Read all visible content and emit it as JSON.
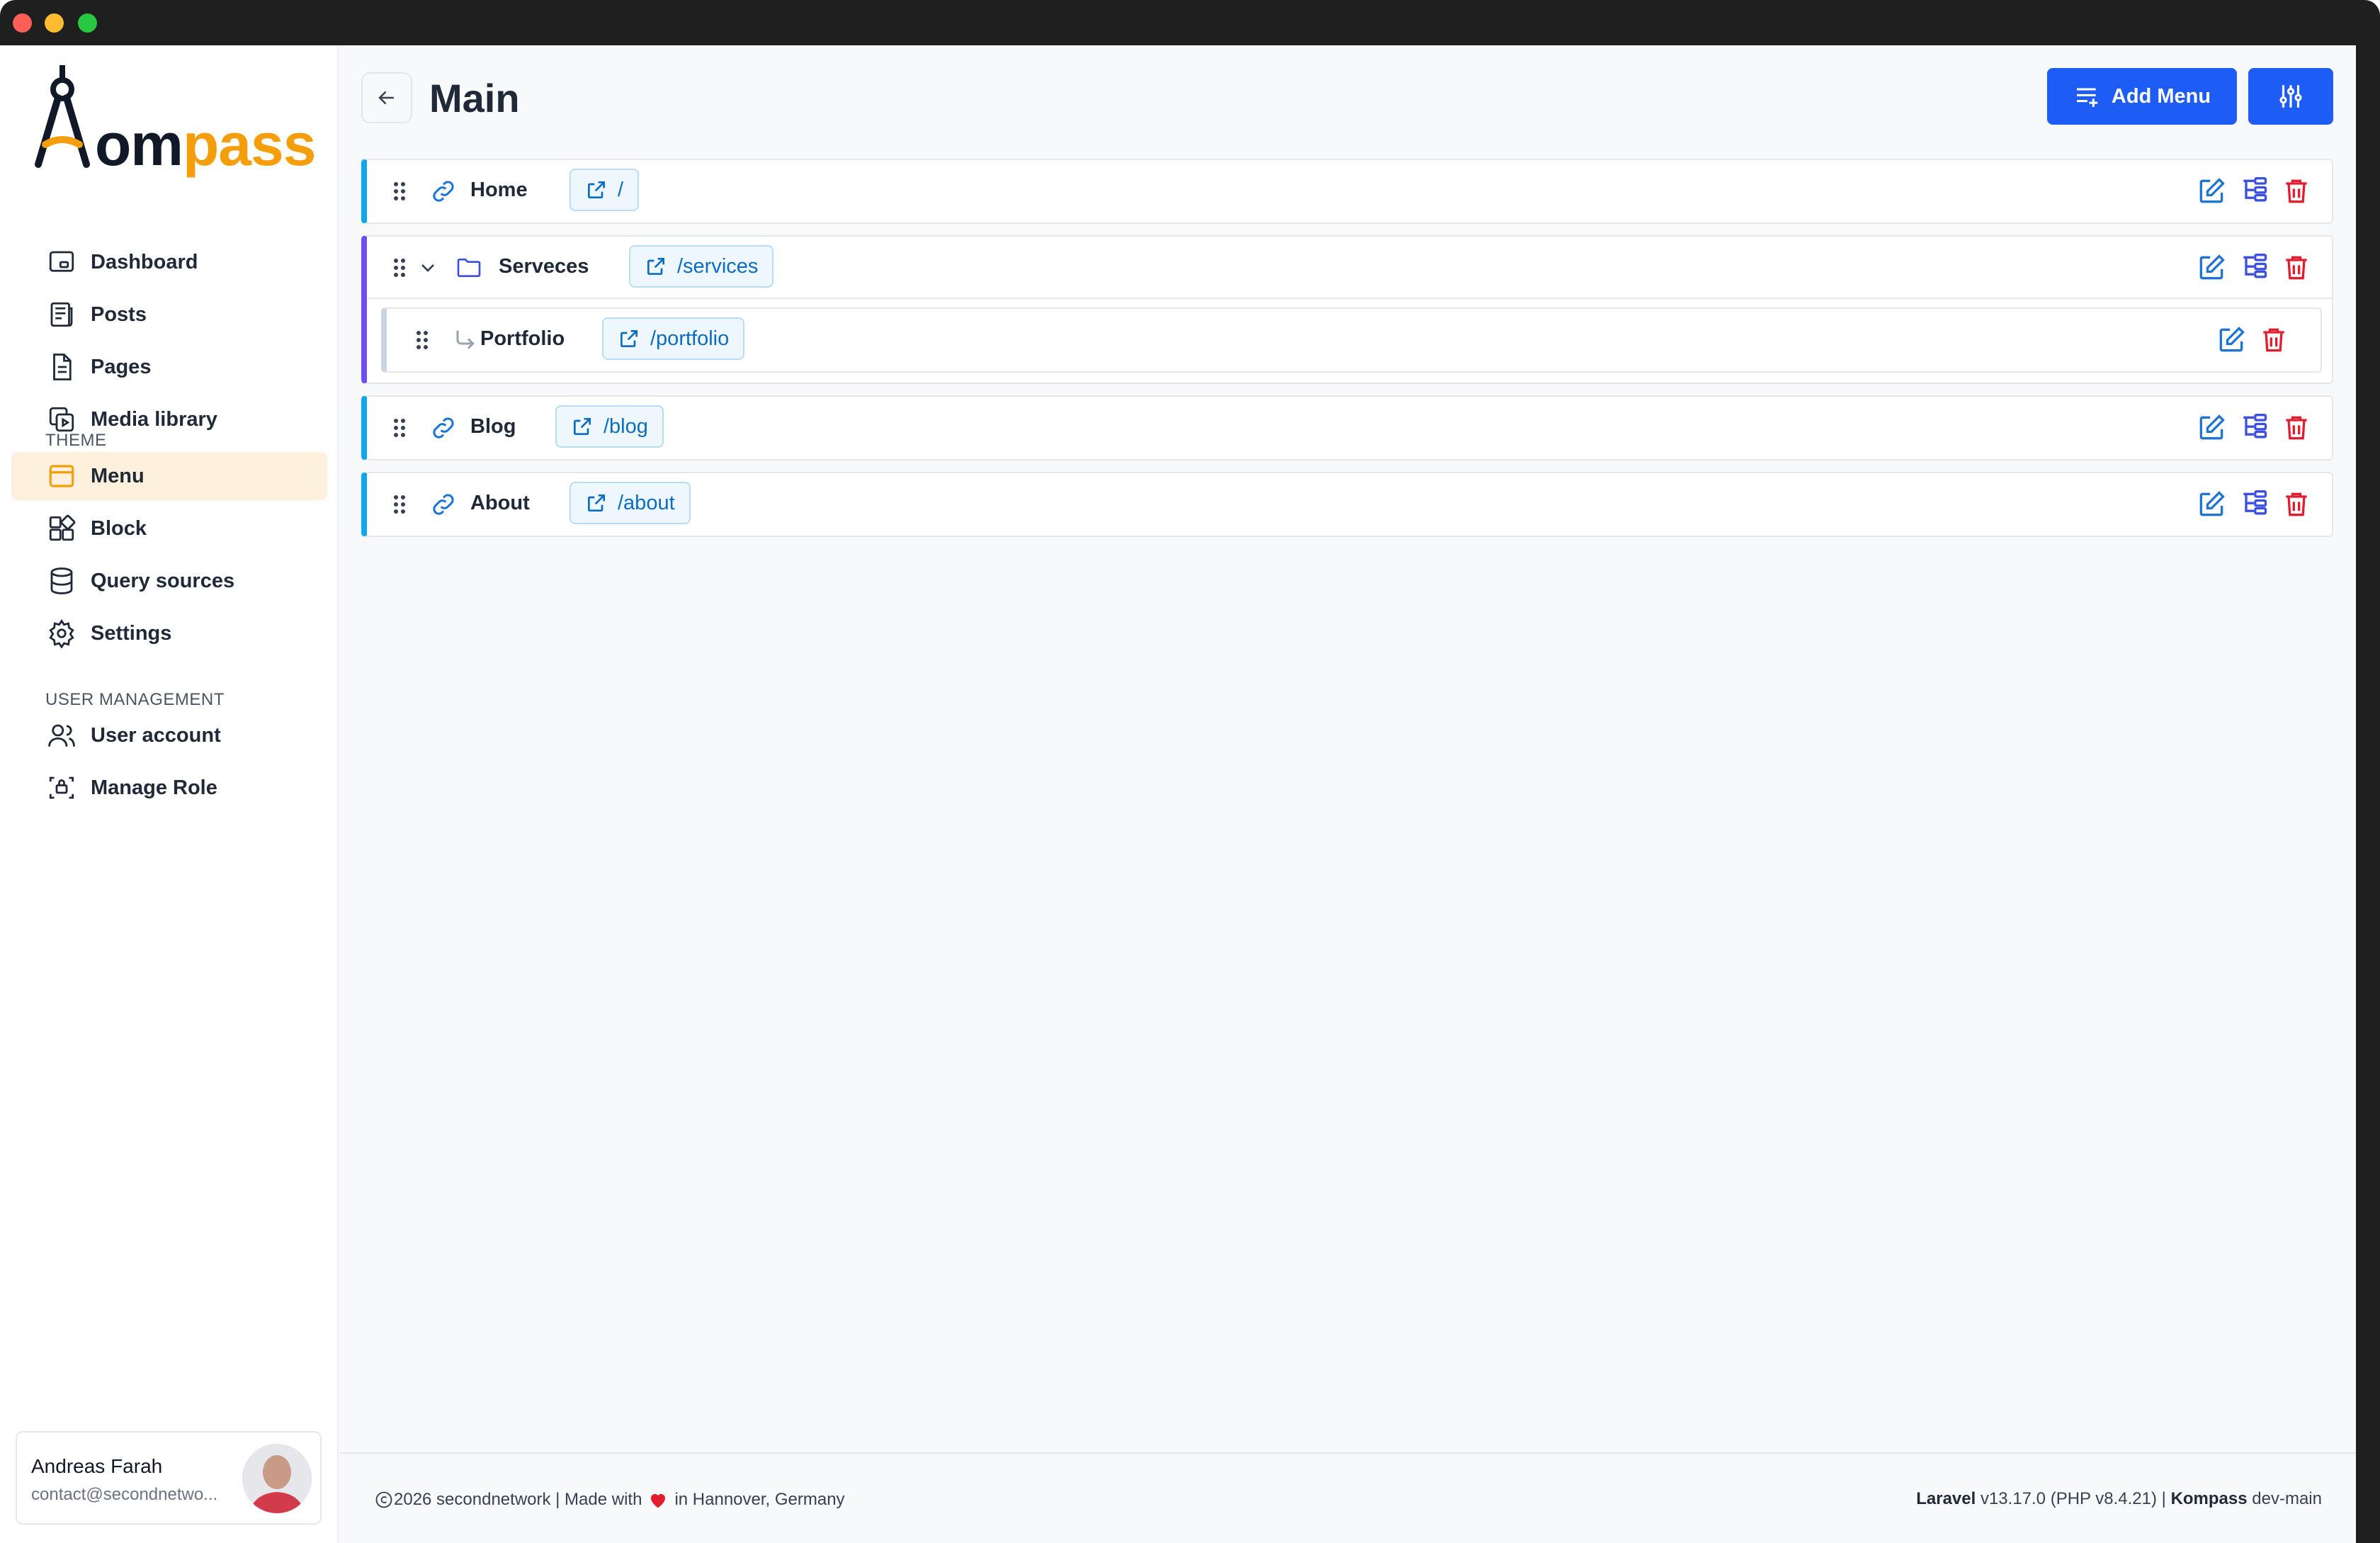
{
  "brand": {
    "logo_text_a": "om",
    "logo_text_b": "pass"
  },
  "sidebar": {
    "main_items": [
      {
        "label": "Dashboard",
        "icon": "dashboard-icon"
      },
      {
        "label": "Posts",
        "icon": "posts-icon"
      },
      {
        "label": "Pages",
        "icon": "pages-icon"
      },
      {
        "label": "Media library",
        "icon": "media-icon"
      }
    ],
    "theme_title": "THEME",
    "theme_items": [
      {
        "label": "Menu",
        "icon": "menu-icon",
        "active": true
      },
      {
        "label": "Block",
        "icon": "block-icon"
      },
      {
        "label": "Query sources",
        "icon": "database-icon"
      },
      {
        "label": "Settings",
        "icon": "gear-icon"
      }
    ],
    "user_mgmt_title": "USER MANAGEMENT",
    "user_items": [
      {
        "label": "User account",
        "icon": "users-icon"
      },
      {
        "label": "Manage Role",
        "icon": "role-icon"
      }
    ],
    "user": {
      "name": "Andreas Farah",
      "email": "contact@secondnetwo..."
    }
  },
  "header": {
    "title": "Main",
    "add_button": "Add Menu"
  },
  "menu_items": [
    {
      "label": "Home",
      "url": "/",
      "type": "link"
    },
    {
      "label": "Serveces",
      "url": "/services",
      "type": "folder",
      "children": [
        {
          "label": "Portfolio",
          "url": "/portfolio"
        }
      ]
    },
    {
      "label": "Blog",
      "url": "/blog",
      "type": "link"
    },
    {
      "label": "About",
      "url": "/about",
      "type": "link"
    }
  ],
  "footer": {
    "left_year": "2026 secondnetwork | Made with",
    "left_tail": "in Hannover, Germany",
    "laravel_label": "Laravel",
    "laravel_version": "v13.17.0 (PHP v8.4.21) |",
    "kompass_label": "Kompass",
    "kompass_branch": "dev-main"
  },
  "colors": {
    "accent": "#1d5cf5",
    "brand_orange": "#f59e0b",
    "link_border": "#10a6e8",
    "folder_border": "#6d4ef0",
    "delete": "#e11d2e"
  }
}
